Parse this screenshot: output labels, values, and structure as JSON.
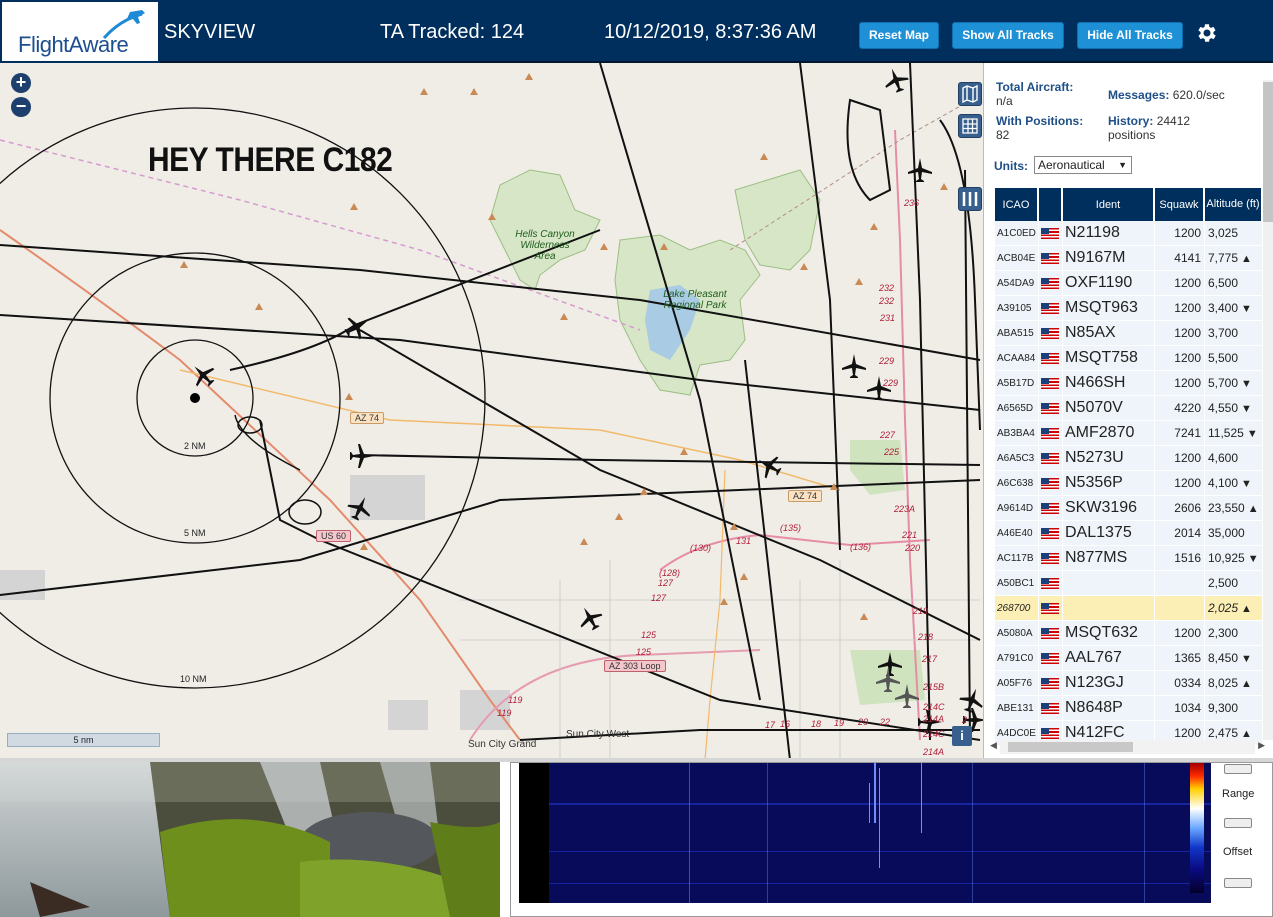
{
  "header": {
    "logo_text": "FlightAware",
    "app_title": "SKYVIEW",
    "tracked_label": "TA Tracked: 124",
    "datetime": "10/12/2019, 8:37:36 AM",
    "buttons": {
      "reset_map": "Reset Map",
      "show_all": "Show All Tracks",
      "hide_all": "Hide All Tracks"
    }
  },
  "map": {
    "overlay_text": "HEY THERE C182",
    "scale_label": "5 nm",
    "rings": [
      "2 NM",
      "5 NM",
      "10 NM"
    ],
    "roads": [
      "AZ 74",
      "AZ 74",
      "US 60",
      "AZ 303 Loop"
    ],
    "route_labels": [
      "(130)",
      "(135)",
      "(136)",
      "(128)"
    ],
    "parks": [
      "Hells Canyon Wilderness Area",
      "Lake Pleasant Regional Park"
    ],
    "places": [
      "Sun City Grand",
      "Sun City West"
    ],
    "exit_numbers": [
      "236",
      "232",
      "232",
      "231",
      "229",
      "229",
      "227",
      "225",
      "223A",
      "221",
      "220",
      "219",
      "218",
      "217",
      "215B",
      "214C",
      "214A",
      "214C",
      "214A",
      "131",
      "127",
      "127",
      "125",
      "125",
      "119",
      "119",
      "17",
      "16",
      "18",
      "19",
      "20",
      "22",
      "2"
    ]
  },
  "sidebar": {
    "total_aircraft_label": "Total Aircraft:",
    "total_aircraft_value": "n/a",
    "messages_label": "Messages:",
    "messages_value": "620.0/sec",
    "with_positions_label": "With Positions:",
    "with_positions_value": "82",
    "history_label": "History:",
    "history_value": "24412",
    "history_unit": "positions",
    "units_label": "Units:",
    "units_value": "Aeronautical",
    "columns": [
      "ICAO",
      "",
      "Ident",
      "Squawk",
      "Altitude (ft)"
    ],
    "rows": [
      {
        "icao": "A1C0ED",
        "ident": "N21198",
        "squawk": "1200",
        "alt": "3,025",
        "trend": ""
      },
      {
        "icao": "ACB04E",
        "ident": "N9167M",
        "squawk": "4141",
        "alt": "7,775",
        "trend": "▲"
      },
      {
        "icao": "A54DA9",
        "ident": "OXF1190",
        "squawk": "1200",
        "alt": "6,500",
        "trend": ""
      },
      {
        "icao": "A39105",
        "ident": "MSQT963",
        "squawk": "1200",
        "alt": "3,400",
        "trend": "▼"
      },
      {
        "icao": "ABA515",
        "ident": "N85AX",
        "squawk": "1200",
        "alt": "3,700",
        "trend": ""
      },
      {
        "icao": "ACAA84",
        "ident": "MSQT758",
        "squawk": "1200",
        "alt": "5,500",
        "trend": ""
      },
      {
        "icao": "A5B17D",
        "ident": "N466SH",
        "squawk": "1200",
        "alt": "5,700",
        "trend": "▼"
      },
      {
        "icao": "A6565D",
        "ident": "N5070V",
        "squawk": "4220",
        "alt": "4,550",
        "trend": "▼"
      },
      {
        "icao": "AB3BA4",
        "ident": "AMF2870",
        "squawk": "7241",
        "alt": "11,525",
        "trend": "▼"
      },
      {
        "icao": "A6A5C3",
        "ident": "N5273U",
        "squawk": "1200",
        "alt": "4,600",
        "trend": ""
      },
      {
        "icao": "A6C638",
        "ident": "N5356P",
        "squawk": "1200",
        "alt": "4,100",
        "trend": "▼"
      },
      {
        "icao": "A9614D",
        "ident": "SKW3196",
        "squawk": "2606",
        "alt": "23,550",
        "trend": "▲"
      },
      {
        "icao": "A46E40",
        "ident": "DAL1375",
        "squawk": "2014",
        "alt": "35,000",
        "trend": ""
      },
      {
        "icao": "AC117B",
        "ident": "N877MS",
        "squawk": "1516",
        "alt": "10,925",
        "trend": "▼"
      },
      {
        "icao": "A50BC1",
        "ident": "",
        "squawk": "",
        "alt": "2,500",
        "trend": ""
      },
      {
        "icao": "268700",
        "ident": "",
        "squawk": "",
        "alt": "2,025",
        "trend": "▲",
        "selected": true
      },
      {
        "icao": "A5080A",
        "ident": "MSQT632",
        "squawk": "1200",
        "alt": "2,300",
        "trend": ""
      },
      {
        "icao": "A791C0",
        "ident": "AAL767",
        "squawk": "1365",
        "alt": "8,450",
        "trend": "▼"
      },
      {
        "icao": "A05F76",
        "ident": "N123GJ",
        "squawk": "0334",
        "alt": "8,025",
        "trend": "▲"
      },
      {
        "icao": "ABE131",
        "ident": "N8648P",
        "squawk": "1034",
        "alt": "9,300",
        "trend": ""
      },
      {
        "icao": "A4DC0E",
        "ident": "N412FC",
        "squawk": "1200",
        "alt": "2,475",
        "trend": "▲"
      }
    ]
  },
  "spectrum": {
    "range_label": "Range",
    "offset_label": "Offset"
  },
  "colors": {
    "header_bg": "#002f5d",
    "button_bg": "#1e90d6",
    "table_header": "#002f5d",
    "row_bg": "#eef4fa",
    "selected_row": "#fcefb5"
  }
}
